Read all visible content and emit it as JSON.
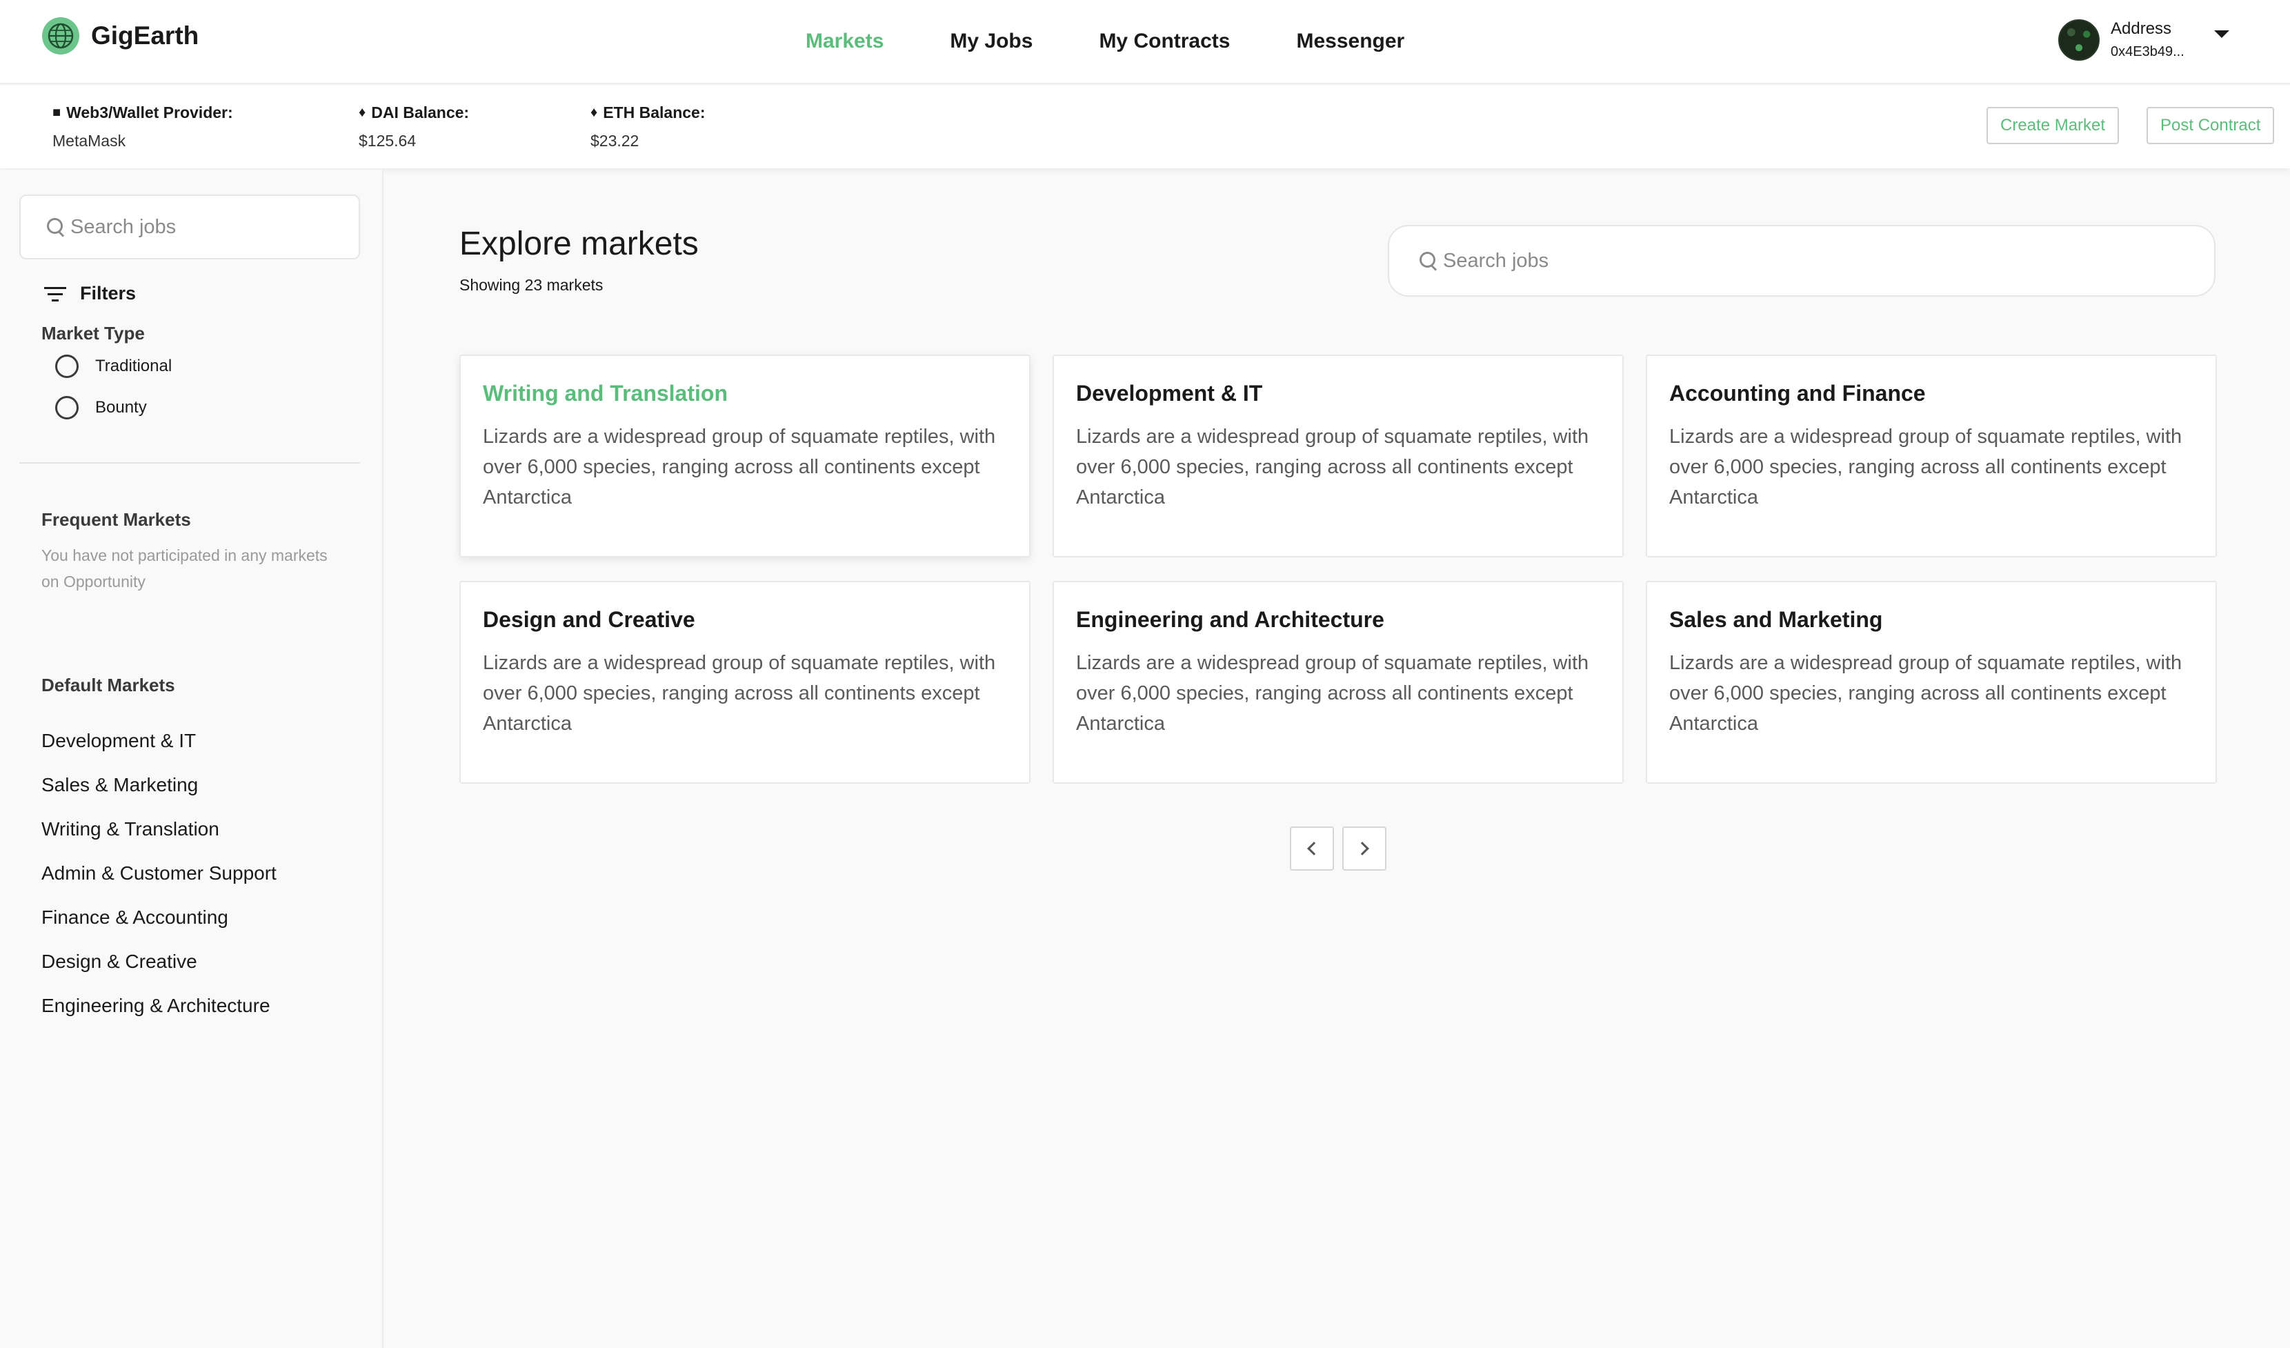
{
  "header": {
    "brand": "GigEarth",
    "nav": [
      {
        "label": "Markets",
        "active": true
      },
      {
        "label": "My Jobs",
        "active": false
      },
      {
        "label": "My Contracts",
        "active": false
      },
      {
        "label": "Messenger",
        "active": false
      }
    ],
    "account": {
      "label": "Address",
      "value": "0x4E3b49..."
    }
  },
  "wallet": {
    "provider": {
      "label": "Web3/Wallet Provider:",
      "value": "MetaMask",
      "icon": "wallet-icon"
    },
    "dai": {
      "label": "DAI Balance:",
      "value": "$125.64",
      "icon": "ethereum-icon"
    },
    "eth": {
      "label": "ETH Balance:",
      "value": "$23.22",
      "icon": "ethereum-icon"
    },
    "create_market": "Create Market",
    "post_contract": "Post Contract"
  },
  "sidebar": {
    "search_placeholder": "Search jobs",
    "filters_label": "Filters",
    "market_type_label": "Market Type",
    "market_types": [
      "Traditional",
      "Bounty"
    ],
    "frequent_label": "Frequent Markets",
    "frequent_note": "You have not participated in any markets on Opportunity",
    "default_label": "Default Markets",
    "default_markets": [
      "Development & IT",
      "Sales & Marketing",
      "Writing & Translation",
      "Admin & Customer Support",
      "Finance & Accounting",
      "Design & Creative",
      "Engineering & Architecture"
    ]
  },
  "main": {
    "title": "Explore markets",
    "count": "Showing 23 markets",
    "search_placeholder": "Search jobs",
    "cards": [
      {
        "title": "Writing and Translation",
        "desc": "Lizards are a widespread group of squamate reptiles, with over 6,000 species, ranging across all continents except Antarctica",
        "active": true
      },
      {
        "title": "Development & IT",
        "desc": "Lizards are a widespread group of squamate reptiles, with over 6,000 species, ranging across all continents except Antarctica",
        "active": false
      },
      {
        "title": "Accounting and Finance",
        "desc": "Lizards are a widespread group of squamate reptiles, with over 6,000 species, ranging across all continents except Antarctica",
        "active": false
      },
      {
        "title": "Design and Creative",
        "desc": "Lizards are a widespread group of squamate reptiles, with over 6,000 species, ranging across all continents except Antarctica",
        "active": false
      },
      {
        "title": "Engineering and Architecture",
        "desc": "Lizards are a widespread group of squamate reptiles, with over 6,000 species, ranging across all continents except Antarctica",
        "active": false
      },
      {
        "title": "Sales and Marketing",
        "desc": "Lizards are a widespread group of squamate reptiles, with over 6,000 species, ranging across all continents except Antarctica",
        "active": false
      }
    ]
  },
  "colors": {
    "accent": "#5bbd7b",
    "background": "#f9f9fa"
  }
}
